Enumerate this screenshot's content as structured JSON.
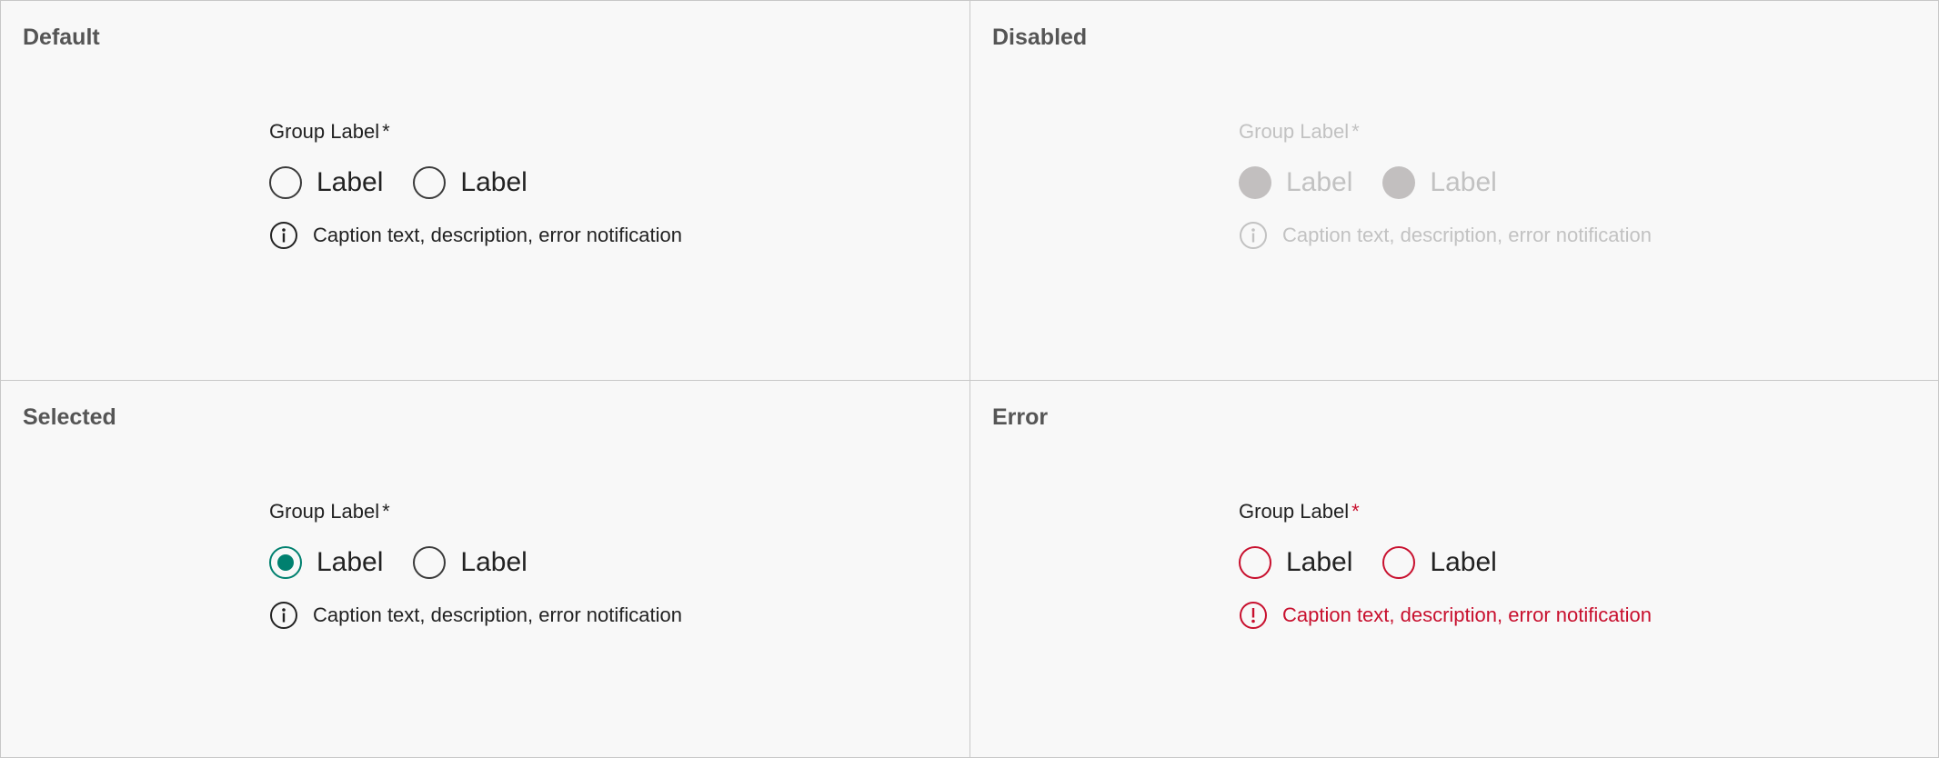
{
  "colors": {
    "accent": "#00806f",
    "error": "#c8102e",
    "disabled": "#c2c2c2",
    "disabled_fill": "#c2bfbf",
    "border": "#c8c8c8",
    "background": "#f8f8f8"
  },
  "panels": {
    "default": {
      "title": "Default",
      "group_label": "Group Label",
      "required_mark": "*",
      "options": [
        {
          "label": "Label",
          "checked": false
        },
        {
          "label": "Label",
          "checked": false
        }
      ],
      "caption_icon": "info-icon",
      "caption": "Caption text, description, error notification"
    },
    "disabled": {
      "title": "Disabled",
      "group_label": "Group Label",
      "required_mark": "*",
      "options": [
        {
          "label": "Label",
          "checked": false
        },
        {
          "label": "Label",
          "checked": false
        }
      ],
      "caption_icon": "info-icon",
      "caption": "Caption text, description, error notification"
    },
    "selected": {
      "title": "Selected",
      "group_label": "Group Label",
      "required_mark": "*",
      "options": [
        {
          "label": "Label",
          "checked": true
        },
        {
          "label": "Label",
          "checked": false
        }
      ],
      "caption_icon": "info-icon",
      "caption": "Caption text, description, error notification"
    },
    "error": {
      "title": "Error",
      "group_label": "Group Label",
      "required_mark": "*",
      "options": [
        {
          "label": "Label",
          "checked": false
        },
        {
          "label": "Label",
          "checked": false
        }
      ],
      "caption_icon": "error-icon",
      "caption": "Caption text, description, error notification"
    }
  }
}
